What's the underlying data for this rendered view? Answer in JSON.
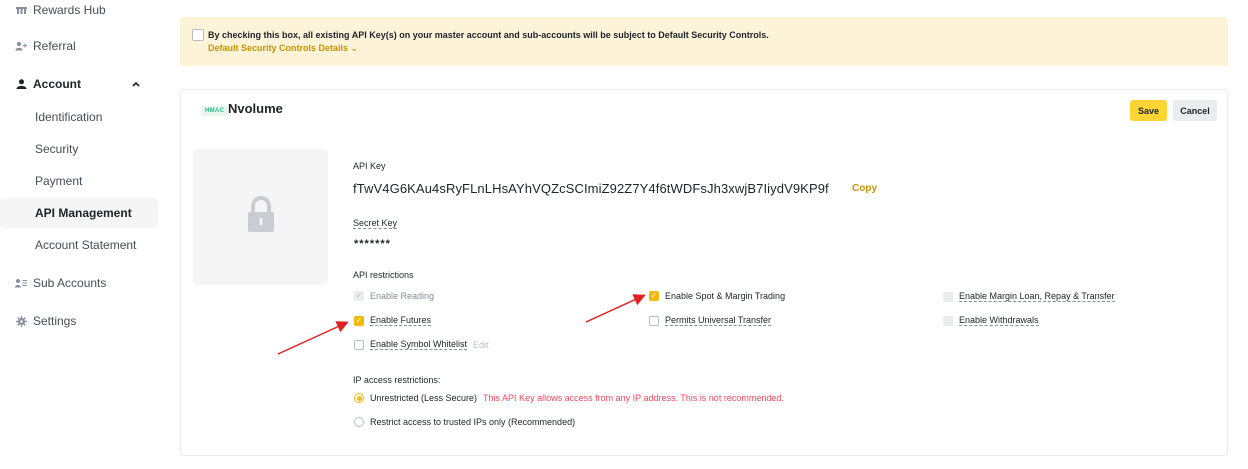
{
  "sidebar": {
    "items": [
      {
        "label": "Rewards Hub",
        "icon": "rewards-icon"
      },
      {
        "label": "Referral",
        "icon": "referral-icon"
      },
      {
        "label": "Account",
        "icon": "account-icon"
      },
      {
        "label": "Sub Accounts",
        "icon": "sub-accounts-icon"
      },
      {
        "label": "Settings",
        "icon": "settings-icon"
      }
    ],
    "account_sub": [
      {
        "label": "Identification"
      },
      {
        "label": "Security"
      },
      {
        "label": "Payment"
      },
      {
        "label": "API Management",
        "active": true
      },
      {
        "label": "Account Statement"
      }
    ]
  },
  "banner": {
    "text": "By checking this box, all existing API Key(s) on your master account and sub-accounts will be subject to Default Security Controls.",
    "link": "Default Security Controls Details ⌄",
    "checked": false
  },
  "card": {
    "badge": "HMAC",
    "name": "Nvolume",
    "save_label": "Save",
    "cancel_label": "Cancel",
    "api_key_label": "API Key",
    "api_key": "fTwV4G6KAu4sRyFLnLHsAYhVQZcSCImiZ92Z7Y4f6tWDFsJh3xwjB7IiydV9KP9f",
    "copy_label": "Copy",
    "secret_key_label": "Secret Key",
    "secret_key": "*******",
    "restrictions_label": "API restrictions",
    "restrictions": {
      "enable_reading": {
        "label": "Enable Reading",
        "checked": true,
        "disabled": true
      },
      "enable_spot_margin": {
        "label": "Enable Spot & Margin Trading",
        "checked": true
      },
      "enable_margin_loan": {
        "label": "Enable Margin Loan, Repay & Transfer",
        "checked": false,
        "disabled": true
      },
      "enable_futures": {
        "label": "Enable Futures",
        "checked": true
      },
      "permits_universal": {
        "label": "Permits Universal Transfer",
        "checked": false
      },
      "enable_withdrawals": {
        "label": "Enable Withdrawals",
        "checked": false,
        "disabled": true
      },
      "enable_symbol_whitelist": {
        "label": "Enable Symbol Whitelist",
        "checked": false
      },
      "edit_label": "Edit"
    },
    "ip_label": "IP access restrictions:",
    "ip_options": {
      "unrestricted": {
        "label": "Unrestricted (Less Secure)",
        "warning": "This API Key allows access from any IP address. This is not recommended.",
        "selected": true
      },
      "restricted": {
        "label": "Restrict access to trusted IPs only (Recommended)",
        "selected": false
      }
    }
  },
  "colors": {
    "accent": "#f0b90b",
    "warning": "#f6465d",
    "banner_bg": "#fcf3d9",
    "annotation_arrow": "#e02020"
  }
}
